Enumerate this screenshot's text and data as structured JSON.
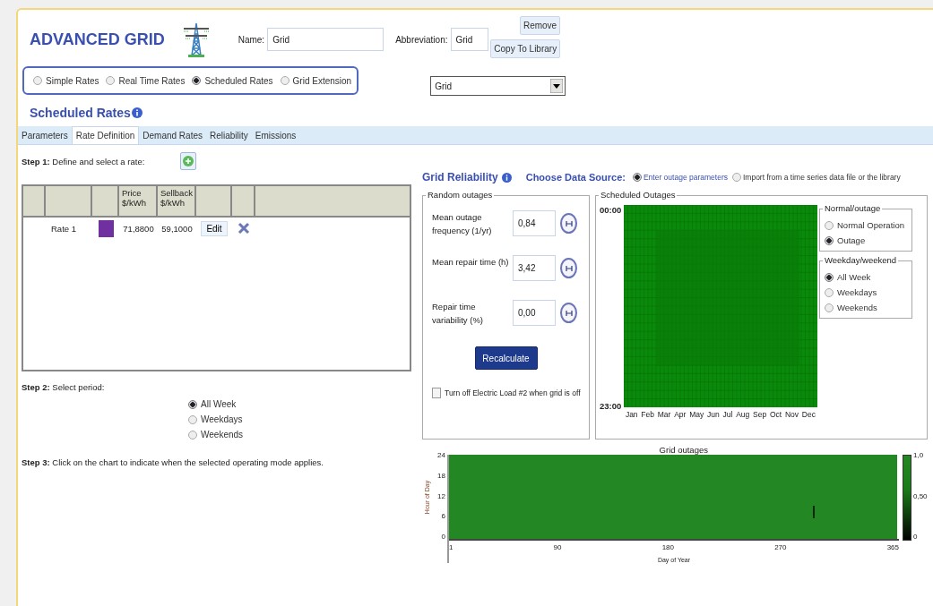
{
  "header": {
    "title": "ADVANCED GRID",
    "name_label": "Name:",
    "name_value": "Grid",
    "abbreviation_label": "Abbreviation:",
    "abbreviation_value": "Grid",
    "buttons": [
      "Remove",
      "Copy To Library"
    ]
  },
  "rate_types": [
    {
      "label": "Simple Rates",
      "selected": false
    },
    {
      "label": "Real Time Rates",
      "selected": false
    },
    {
      "label": "Scheduled Rates",
      "selected": true
    },
    {
      "label": "Grid Extension",
      "selected": false
    }
  ],
  "library_dropdown": {
    "value": "Grid"
  },
  "section_title": "Scheduled Rates",
  "tabs": [
    {
      "label": "Parameters",
      "selected": false
    },
    {
      "label": "Rate Definition",
      "selected": true
    },
    {
      "label": "Demand Rates",
      "selected": false
    },
    {
      "label": "Reliability",
      "selected": false
    },
    {
      "label": "Emissions",
      "selected": false
    }
  ],
  "step1": "**Step 1:** Define and select a rate:",
  "rates_table": {
    "columns": [
      "Price $/kWh",
      "Sellback $/kWh"
    ],
    "rows": [
      {
        "name": "Rate 1",
        "color": "#7030a0",
        "price": "71,8800",
        "sellback": "59,1000",
        "action": "Edit"
      }
    ]
  },
  "step2": "**Step 2:** Select period:",
  "periods": [
    {
      "label": "All Week",
      "selected": true
    },
    {
      "label": "Weekdays",
      "selected": false
    },
    {
      "label": "Weekends",
      "selected": false
    }
  ],
  "step3": "**Step 3:** Click on the chart to indicate when the selected operating mode applies.",
  "reliability": {
    "title": "Grid Reliability",
    "data_source_label": "Choose Data Source:",
    "sources": [
      {
        "label": "Enter outage parameters",
        "selected": true
      },
      {
        "label": "Import from a time series data file or the library",
        "selected": false
      }
    ],
    "random_outages": {
      "legend": "Random outages",
      "fields": [
        {
          "label": "Mean outage frequency (1/yr)",
          "value": "0,84"
        },
        {
          "label": "Mean repair time (h)",
          "value": "3,42"
        },
        {
          "label": "Repair time variability (%)",
          "value": "0,00"
        }
      ],
      "button": "Recalculate",
      "checkbox": {
        "label": "Turn off Electric Load #2 when grid is off",
        "checked": false
      }
    },
    "scheduled_outages": {
      "legend": "Scheduled Outages",
      "start_hour": "00:00",
      "end_hour": "23:00",
      "months": [
        "Jan",
        "Feb",
        "Mar",
        "Apr",
        "May",
        "Jun",
        "Jul",
        "Aug",
        "Sep",
        "Oct",
        "Nov",
        "Dec"
      ],
      "normal_outage": {
        "legend": "Normal/outage",
        "options": [
          {
            "label": "Normal Operation",
            "selected": false
          },
          {
            "label": "Outage",
            "selected": true
          }
        ]
      },
      "weekday_weekend": {
        "legend": "Weekday/weekend",
        "options": [
          {
            "label": "All Week",
            "selected": true
          },
          {
            "label": "Weekdays",
            "selected": false
          },
          {
            "label": "Weekends",
            "selected": false
          }
        ]
      }
    },
    "grid_outages_chart": {
      "title": "Grid outages",
      "ylabel": "Hour of Day",
      "xlabel": "Day of Year",
      "yticks": [
        "24",
        "18",
        "12",
        "6",
        "0"
      ],
      "xticks": [
        "1",
        "90",
        "180",
        "270",
        "365"
      ],
      "colorbar_ticks": [
        "1,0",
        "0,50",
        "0"
      ]
    }
  }
}
